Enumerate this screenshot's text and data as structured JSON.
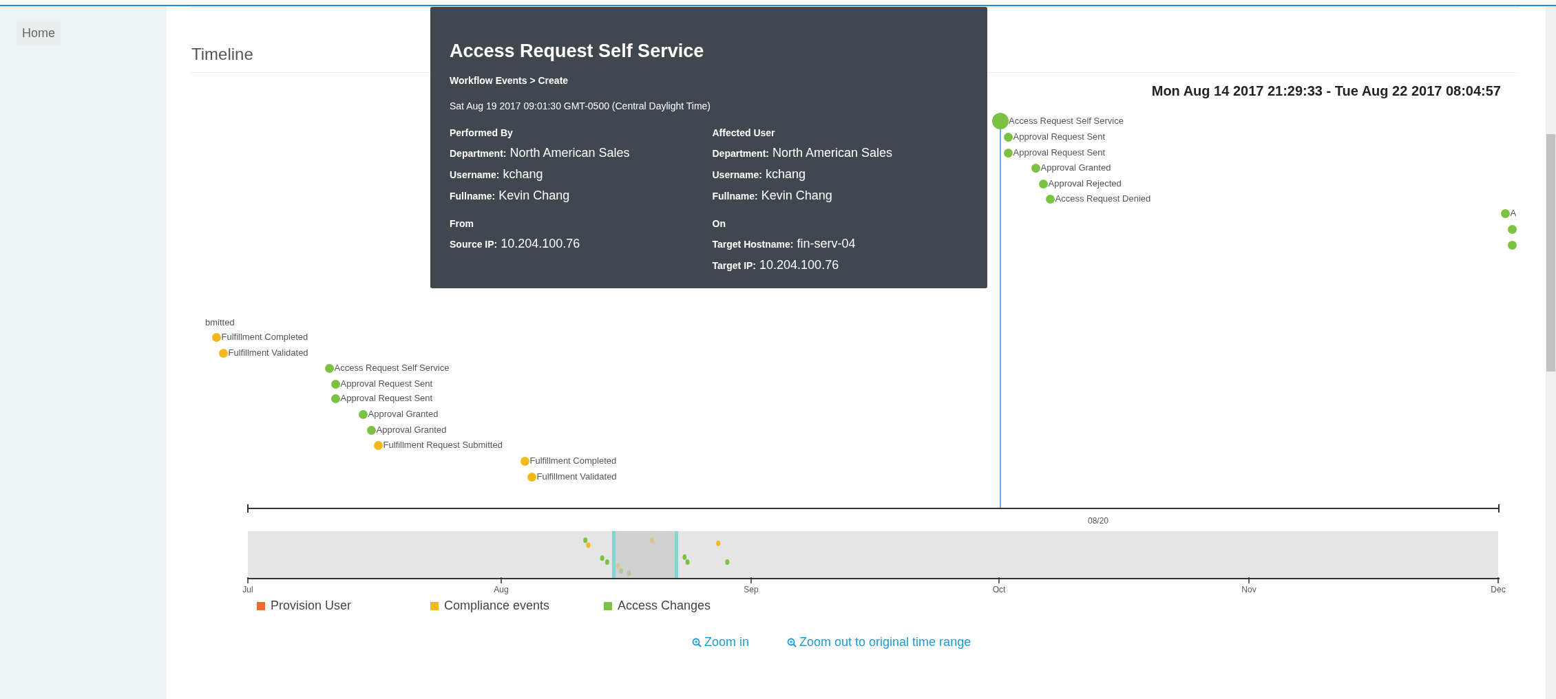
{
  "sidebar": {
    "items": [
      {
        "label": "Home"
      }
    ]
  },
  "timeline": {
    "title": "Timeline",
    "range": "Mon Aug 14 2017 21:29:33 - Tue Aug 22 2017 08:04:57",
    "cut_label": "bmitted",
    "events": [
      {
        "label": "Fulfillment Completed",
        "color": "#f2b81c",
        "selected": false
      },
      {
        "label": "Fulfillment Validated",
        "color": "#f2b81c",
        "selected": false
      },
      {
        "label": "Access Request Self Service",
        "color": "#7cc242",
        "selected": false
      },
      {
        "label": "Approval Request Sent",
        "color": "#7cc242",
        "selected": false
      },
      {
        "label": "Approval Request Sent",
        "color": "#7cc242",
        "selected": false
      },
      {
        "label": "Approval Granted",
        "color": "#7cc242",
        "selected": false
      },
      {
        "label": "Approval Granted",
        "color": "#7cc242",
        "selected": false
      },
      {
        "label": "Fulfillment Request Submitted",
        "color": "#f2b81c",
        "selected": false
      },
      {
        "label": "Fulfillment Completed",
        "color": "#f2b81c",
        "selected": false
      },
      {
        "label": "Fulfillment Validated",
        "color": "#f2b81c",
        "selected": false
      },
      {
        "label": "Access Request Self Service",
        "color": "#7cc242",
        "selected": true
      },
      {
        "label": "Approval Request Sent",
        "color": "#7cc242",
        "selected": false
      },
      {
        "label": "Approval Request Sent",
        "color": "#7cc242",
        "selected": false
      },
      {
        "label": "Approval Granted",
        "color": "#7cc242",
        "selected": false
      },
      {
        "label": "Approval Rejected",
        "color": "#7cc242",
        "selected": false
      },
      {
        "label": "Access Request Denied",
        "color": "#7cc242",
        "selected": false
      },
      {
        "label": "A",
        "color": "#7cc242",
        "selected": false
      },
      {
        "color": "#7cc242",
        "selected": false
      },
      {
        "color": "#7cc242",
        "selected": false
      }
    ],
    "tooltip": {
      "title": "Access Request Self Service",
      "path": "Workflow Events > Create",
      "timestamp": "Sat Aug 19 2017 09:01:30 GMT-0500 (Central Daylight Time)",
      "sections": [
        {
          "heading": "Performed By",
          "fields": [
            {
              "label": "Department:",
              "value": "North American Sales"
            },
            {
              "label": "Username:",
              "value": "kchang"
            },
            {
              "label": "Fullname:",
              "value": "Kevin Chang"
            }
          ]
        },
        {
          "heading": "Affected User",
          "fields": [
            {
              "label": "Department:",
              "value": "North American Sales"
            },
            {
              "label": "Username:",
              "value": "kchang"
            },
            {
              "label": "Fullname:",
              "value": "Kevin Chang"
            }
          ]
        },
        {
          "heading": "From",
          "fields": [
            {
              "label": "Source IP:",
              "value": "10.204.100.76"
            }
          ]
        },
        {
          "heading": "On",
          "fields": [
            {
              "label": "Target Hostname:",
              "value": "fin-serv-04"
            },
            {
              "label": "Target IP:",
              "value": "10.204.100.76"
            }
          ]
        }
      ]
    },
    "top_axis_label": "08/20",
    "months": [
      "Jul",
      "Aug",
      "Sep",
      "Oct",
      "Nov",
      "Dec"
    ],
    "legend": [
      {
        "label": "Provision User",
        "color": "#ee6b2b"
      },
      {
        "label": "Compliance events",
        "color": "#f2b81c"
      },
      {
        "label": "Access Changes",
        "color": "#7cc242"
      }
    ],
    "links": [
      "Zoom in",
      "Zoom out to original time range"
    ]
  }
}
